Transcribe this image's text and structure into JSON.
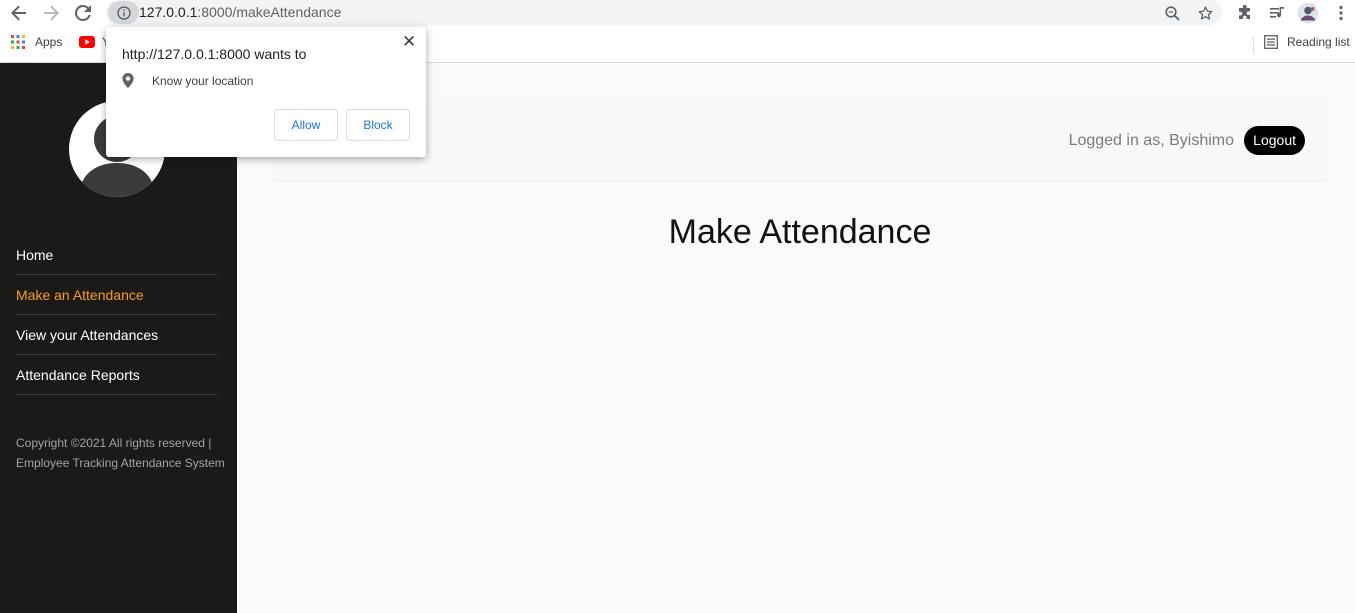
{
  "browser": {
    "url_host": "127.0.0.1",
    "url_port_path": ":8000/makeAttendance",
    "bookmarks": {
      "apps_label": "Apps",
      "youtube_label": "Y",
      "reading_list": "Reading list"
    },
    "icons": [
      "back-icon",
      "forward-icon",
      "reload-icon",
      "info-icon",
      "zoom-icon",
      "star-icon",
      "extensions-icon",
      "media-icon",
      "profile-avatar",
      "menu-icon"
    ]
  },
  "permission_popup": {
    "title": "http://127.0.0.1:8000 wants to",
    "permission": "Know your location",
    "allow_label": "Allow",
    "block_label": "Block",
    "close_symbol": "✕"
  },
  "sidebar": {
    "items": [
      {
        "label": "Home",
        "active": false
      },
      {
        "label": "Make an Attendance",
        "active": true
      },
      {
        "label": "View your Attendances",
        "active": false
      },
      {
        "label": "Attendance Reports",
        "active": false
      }
    ],
    "copyright": "Copyright ©2021 All rights reserved | Employee Tracking Attendance System"
  },
  "header": {
    "logged_in_text": "Logged in as, Byishimo",
    "logout_label": "Logout"
  },
  "main": {
    "title": "Make Attendance"
  },
  "colors": {
    "sidebar_bg": "#1c1a19",
    "active_link": "#f89d13",
    "logout_bg": "#000000",
    "popup_button_text": "#1a73e8"
  }
}
